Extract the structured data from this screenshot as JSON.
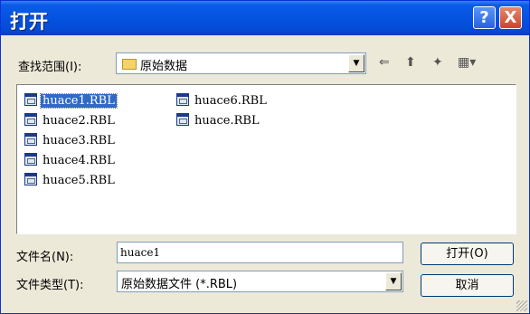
{
  "window": {
    "title": "打开",
    "help": "?",
    "close": "X"
  },
  "lookin": {
    "label": "查找范围(I):",
    "value": "原始数据"
  },
  "files": [
    {
      "name": "huace1.RBL",
      "selected": true
    },
    {
      "name": "huace2.RBL"
    },
    {
      "name": "huace3.RBL"
    },
    {
      "name": "huace4.RBL"
    },
    {
      "name": "huace5.RBL"
    },
    {
      "name": "huace6.RBL"
    },
    {
      "name": "huace.RBL"
    }
  ],
  "filename": {
    "label": "文件名(N):",
    "value": "huace1"
  },
  "filetype": {
    "label": "文件类型(T):",
    "value": "原始数据文件 (*.RBL)"
  },
  "buttons": {
    "open": "打开(O)",
    "cancel": "取消"
  },
  "colors": {
    "titlebar": "#0553e0",
    "face": "#ece9d8",
    "selection": "#316ac5"
  }
}
